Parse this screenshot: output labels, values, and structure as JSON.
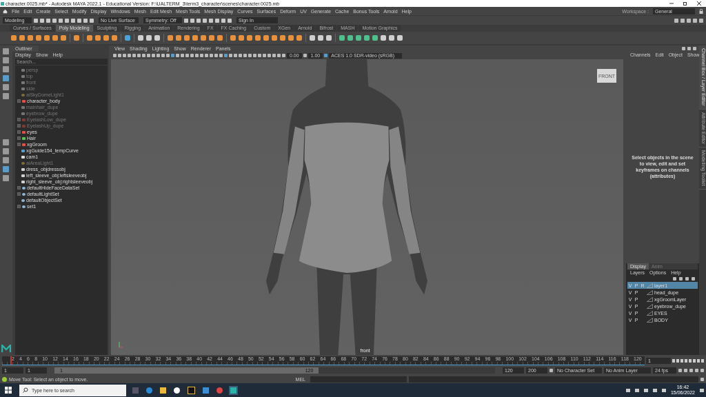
{
  "window": {
    "title": "character.0025.mb* - Autodesk MAYA 2022.1 - Educational Version: F:\\UALTERM_3\\term3_character\\scenes\\character.0025.mb"
  },
  "menu": [
    "File",
    "Edit",
    "Create",
    "Select",
    "Modify",
    "Display",
    "Windows",
    "Mesh",
    "Edit Mesh",
    "Mesh Tools",
    "Mesh Display",
    "Curves",
    "Surfaces",
    "Deform",
    "UV",
    "Generate",
    "Cache",
    "Bonus Tools",
    "Arnold",
    "Help"
  ],
  "workspace": {
    "label": "Workspace :",
    "value": "General"
  },
  "status_line": {
    "mode": "Modeling",
    "live_surface": "No Live Surface",
    "symmetry": "Symmetry: Off",
    "sign_in": "Sign In"
  },
  "shelf_tabs": [
    {
      "label": "Curves / Surfaces",
      "selected": false
    },
    {
      "label": "Poly Modeling",
      "selected": true
    },
    {
      "label": "Sculpting",
      "selected": false
    },
    {
      "label": "Rigging",
      "selected": false
    },
    {
      "label": "Animation",
      "selected": false
    },
    {
      "label": "Rendering",
      "selected": false
    },
    {
      "label": "FX",
      "selected": false
    },
    {
      "label": "FX Caching",
      "selected": false
    },
    {
      "label": "Custom",
      "selected": false
    },
    {
      "label": "XGen",
      "selected": false
    },
    {
      "label": "Arnold",
      "selected": false
    },
    {
      "label": "Bifrost",
      "selected": false
    },
    {
      "label": "MASH",
      "selected": false
    },
    {
      "label": "Motion Graphics",
      "selected": false
    }
  ],
  "outliner": {
    "title": "Outliner",
    "menu": [
      "Display",
      "Show",
      "Help"
    ],
    "search": {
      "placeholder": "Search..."
    },
    "items": [
      {
        "name": "persp",
        "kind": "camera",
        "dimmed": true,
        "expandable": false
      },
      {
        "name": "top",
        "kind": "camera",
        "dimmed": true,
        "expandable": false
      },
      {
        "name": "front",
        "kind": "camera",
        "dimmed": true,
        "expandable": false
      },
      {
        "name": "side",
        "kind": "camera",
        "dimmed": true,
        "expandable": false
      },
      {
        "name": "aiSkyDomeLight1",
        "kind": "light",
        "dimmed": true,
        "expandable": false
      },
      {
        "name": "character_body",
        "kind": "mesh",
        "dimmed": false,
        "expandable": true
      },
      {
        "name": "mainhair_dupe",
        "kind": "group",
        "dimmed": true,
        "expandable": false
      },
      {
        "name": "eyebrow_dupe",
        "kind": "group",
        "dimmed": true,
        "expandable": false
      },
      {
        "name": "EyelashLow_dupe",
        "kind": "mesh",
        "dimmed": true,
        "expandable": true
      },
      {
        "name": "EyelashUp_dupe",
        "kind": "mesh",
        "dimmed": true,
        "expandable": true
      },
      {
        "name": "eyes",
        "kind": "mesh",
        "dimmed": false,
        "expandable": true
      },
      {
        "name": "Hair",
        "kind": "hair",
        "dimmed": false,
        "expandable": true
      },
      {
        "name": "xgGroom",
        "kind": "mesh",
        "dimmed": false,
        "expandable": true
      },
      {
        "name": "xgGuide154_tempCurve",
        "kind": "curve",
        "dimmed": false,
        "expandable": false
      },
      {
        "name": "cam1",
        "kind": "camera",
        "dimmed": false,
        "expandable": false
      },
      {
        "name": "aiAreaLight1",
        "kind": "light",
        "dimmed": true,
        "expandable": false
      },
      {
        "name": "dress_objdressobj",
        "kind": "group",
        "dimmed": false,
        "expandable": false
      },
      {
        "name": "left_sleeve_obj:leftsleeveobj",
        "kind": "group",
        "dimmed": false,
        "expandable": false
      },
      {
        "name": "right_sleeve_obj:rightsleeveobj",
        "kind": "group",
        "dimmed": false,
        "expandable": false
      },
      {
        "name": "defaultHideFaceDataSet",
        "kind": "set",
        "dimmed": false,
        "expandable": true
      },
      {
        "name": "defaultLightSet",
        "kind": "set",
        "dimmed": false,
        "expandable": true
      },
      {
        "name": "defaultObjectSet",
        "kind": "set",
        "dimmed": false,
        "expandable": false
      },
      {
        "name": "set1",
        "kind": "set",
        "dimmed": false,
        "expandable": true
      }
    ]
  },
  "viewport": {
    "menu": [
      "View",
      "Shading",
      "Lighting",
      "Show",
      "Renderer",
      "Panels"
    ],
    "exposure": "0.00",
    "gamma": "1.00",
    "color_space": "ACES 1.0 SDR-video (sRGB)",
    "view_cube": "FRONT",
    "camera_label": "front"
  },
  "channel_box": {
    "menu": [
      "Channels",
      "Edit",
      "Object",
      "Show"
    ],
    "message": "Select objects in the scene to view, edit and set keyframes on channels (attributes)"
  },
  "side_tabs": [
    {
      "label": "Channel Box / Layer Editor",
      "selected": true
    },
    {
      "label": "Attribute Editor",
      "selected": false
    },
    {
      "label": "Modelling Toolkit",
      "selected": false
    }
  ],
  "layer_editor": {
    "tabs": [
      {
        "label": "Display",
        "selected": true
      },
      {
        "label": "Anim",
        "selected": false
      }
    ],
    "menu": [
      "Layers",
      "Options",
      "Help"
    ],
    "layers": [
      {
        "v": "V",
        "p": "P",
        "r": "R",
        "name": "layer1",
        "selected": true
      },
      {
        "v": "V",
        "p": "P",
        "name": "head_dupe",
        "selected": false
      },
      {
        "v": "V",
        "p": "P",
        "name": "xgGroomLayer",
        "selected": false
      },
      {
        "v": "V",
        "p": "P",
        "name": "eyebrow_dupe",
        "selected": false
      },
      {
        "v": "V",
        "p": "P",
        "name": "EYES",
        "selected": false
      },
      {
        "v": "V",
        "p": "P",
        "name": "BODY",
        "selected": false
      }
    ]
  },
  "time_slider": {
    "ticks": [
      "2",
      "4",
      "6",
      "8",
      "10",
      "12",
      "14",
      "16",
      "18",
      "20",
      "22",
      "24",
      "26",
      "28",
      "30",
      "32",
      "34",
      "36",
      "38",
      "40",
      "42",
      "44",
      "46",
      "48",
      "50",
      "52",
      "54",
      "56",
      "58",
      "60",
      "62",
      "64",
      "66",
      "68",
      "70",
      "72",
      "74",
      "76",
      "78",
      "80",
      "82",
      "84",
      "86",
      "88",
      "90",
      "92",
      "94",
      "96",
      "98",
      "100",
      "102",
      "104",
      "106",
      "108",
      "110",
      "112",
      "114",
      "116",
      "118",
      "120"
    ],
    "level": 0,
    "current_frame": "1"
  },
  "range_slider": {
    "start": "1",
    "playback_start": "1",
    "range_start": "1",
    "range_end": "120",
    "level": 0.6,
    "playback_end": "120",
    "end": "200",
    "character_set": "No Character Set",
    "anim_layer": "No Anim Layer",
    "fps": "24 fps"
  },
  "help_line": {
    "message": "Move Tool: Select an object to move.",
    "command_label": "MEL"
  },
  "taskbar": {
    "search": {
      "placeholder": "Type here to search"
    },
    "time": "16:42",
    "date": "15/06/2022"
  }
}
